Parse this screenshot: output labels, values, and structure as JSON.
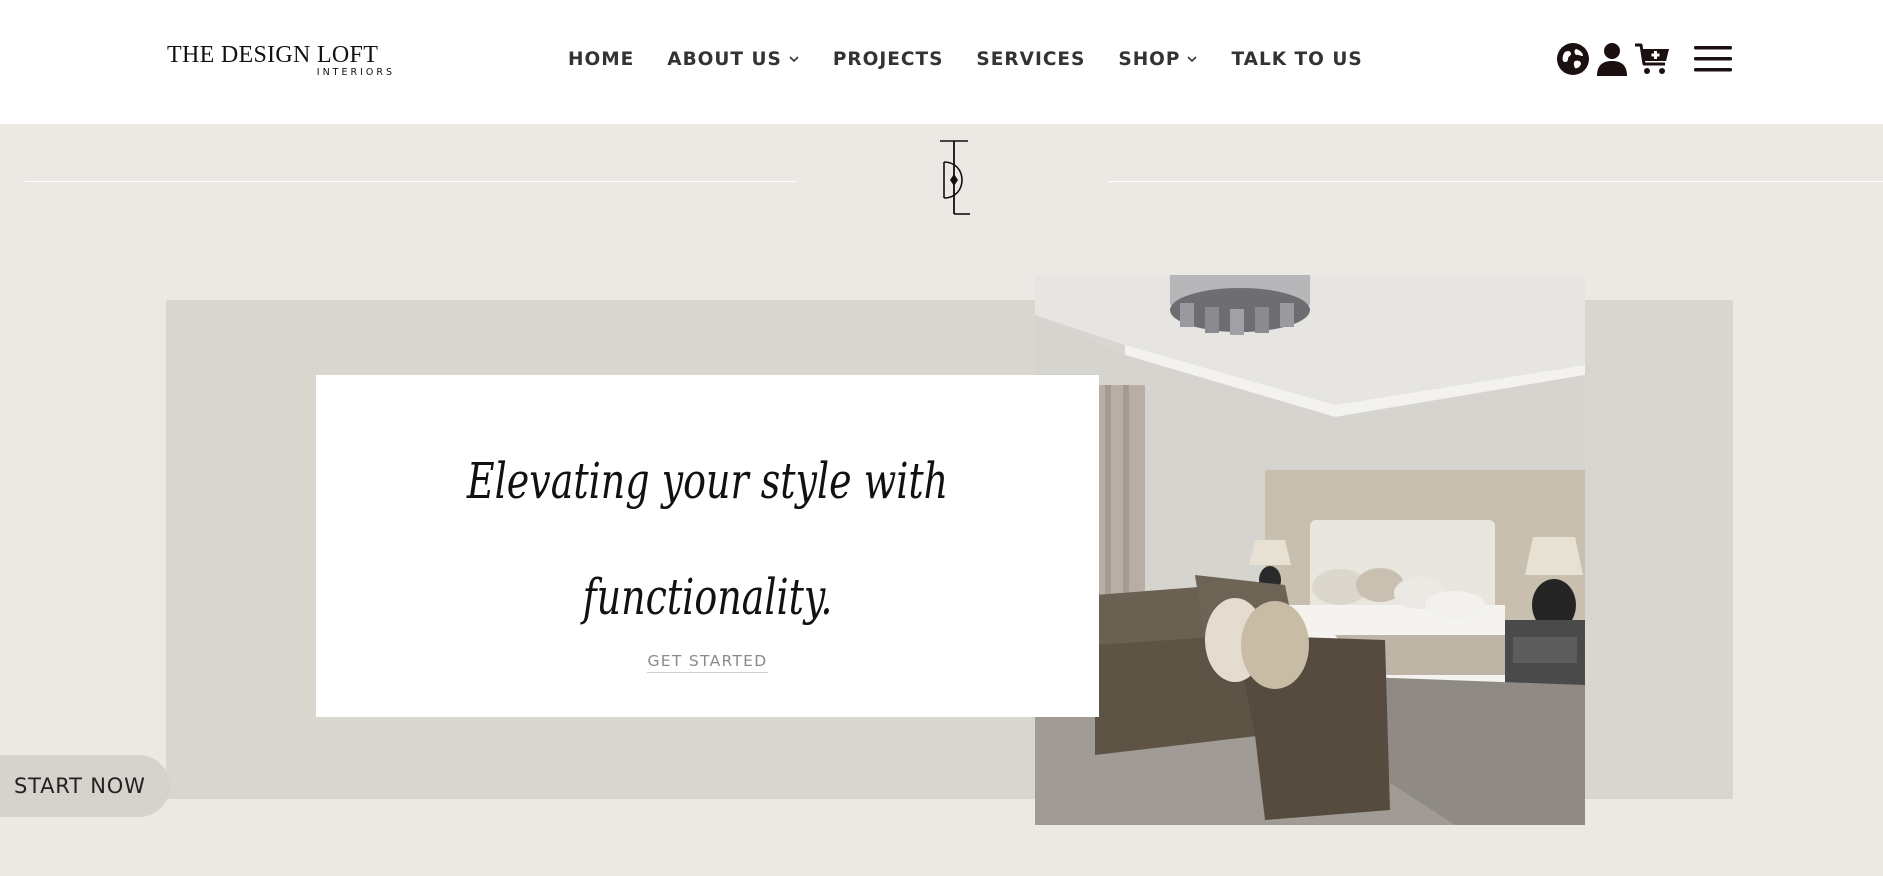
{
  "brand": {
    "name": "THE DESIGN LOFT",
    "sub": "INTERIORS"
  },
  "nav": {
    "items": [
      {
        "label": "HOME"
      },
      {
        "label": "ABOUT US",
        "dropdown": true
      },
      {
        "label": "PROJECTS"
      },
      {
        "label": "SERVICES"
      },
      {
        "label": "SHOP",
        "dropdown": true
      },
      {
        "label": "TALK TO US"
      }
    ]
  },
  "header_icons": [
    "globe-icon",
    "user-icon",
    "cart-add-icon",
    "hamburger-menu-icon"
  ],
  "hero": {
    "headline_line1": "Elevating your style with",
    "headline_line2": "functionality.",
    "cta_label": "GET STARTED"
  },
  "floating_cta": {
    "label": "START NOW"
  },
  "colors": {
    "page_bg": "#ece9e5",
    "band_bg": "#d9d6d0",
    "header_bg": "#ffffff",
    "text_dark": "#111111",
    "cta_text": "#8a8a8a",
    "icon_dark": "#1c0f0f"
  }
}
